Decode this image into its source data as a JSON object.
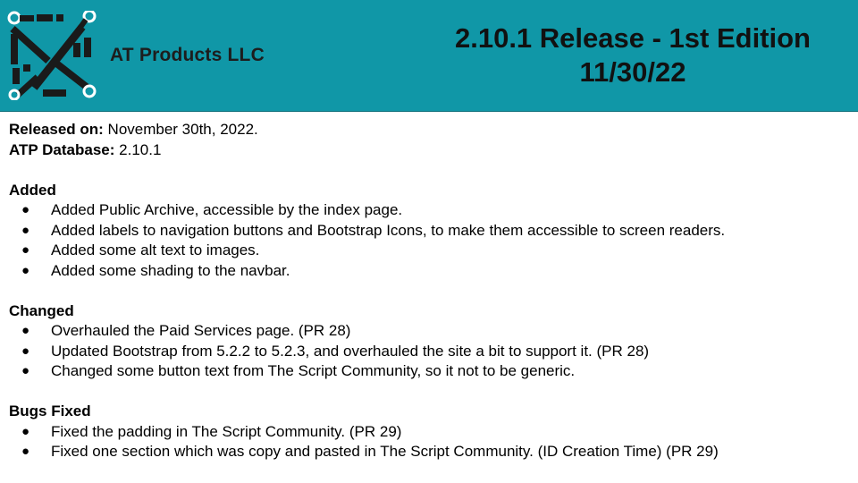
{
  "header": {
    "brand": "AT Products LLC",
    "title_line1": "2.10.1 Release - 1st Edition",
    "title_line2": "11/30/22",
    "logo_icon": "circuit-logo-icon",
    "background_color": "#1097a7"
  },
  "meta": {
    "released_label": "Released on:",
    "released_value": " November 30th, 2022.",
    "db_label": "ATP Database:",
    "db_value": " 2.10.1"
  },
  "sections": [
    {
      "heading": "Added",
      "items": [
        "Added Public Archive, accessible by the index page.",
        "Added labels to navigation buttons and Bootstrap Icons, to make them accessible to screen readers.",
        "Added some alt text to images.",
        "Added some shading to the navbar."
      ]
    },
    {
      "heading": "Changed",
      "items": [
        "Overhauled the Paid Services page. (PR 28)",
        "Updated Bootstrap from 5.2.2 to 5.2.3, and overhauled the site a bit to support it. (PR 28)",
        "Changed some button text from The Script Community, so it not to be generic."
      ]
    },
    {
      "heading": "Bugs Fixed",
      "items": [
        "Fixed the padding in The Script Community. (PR 29)",
        "Fixed one section which was copy and pasted in The Script Community. (ID Creation Time) (PR 29)"
      ]
    }
  ],
  "bullet_char": "●"
}
